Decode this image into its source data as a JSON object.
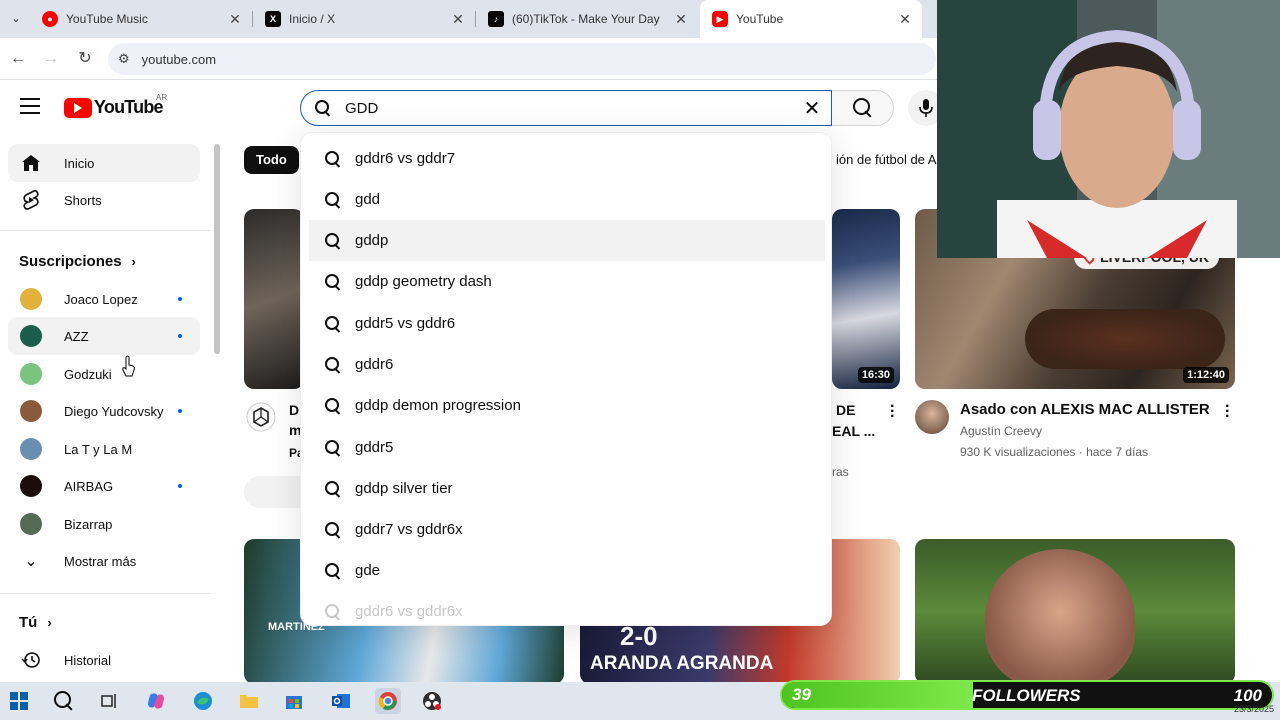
{
  "browser": {
    "tabs": [
      {
        "title": "YouTube Music",
        "favicon_color": "#ff0000"
      },
      {
        "title": "Inicio / X",
        "favicon_color": "#000000"
      },
      {
        "title": "(60)TikTok - Make Your Day",
        "favicon_color": "#000000"
      },
      {
        "title": "YouTube",
        "favicon_color": "#ff0000",
        "active": true
      }
    ],
    "close_glyph": "✕",
    "url": "youtube.com"
  },
  "masthead": {
    "logo_text": "YouTube",
    "region": "AR",
    "search_value": "GDD",
    "clear_glyph": "✕"
  },
  "sidebar": {
    "main": [
      {
        "label": "Inicio"
      },
      {
        "label": "Shorts"
      }
    ],
    "subscriptions_heading": "Suscripciones",
    "subscriptions": [
      {
        "label": "Joaco Lopez",
        "new": true,
        "color": "#e0b23a"
      },
      {
        "label": "AZZ",
        "new": true,
        "color": "#1a5e4a"
      },
      {
        "label": "Godzuki",
        "new": false,
        "color": "#7bc47f"
      },
      {
        "label": "Diego Yudcovsky",
        "new": true,
        "color": "#8a5a3c"
      },
      {
        "label": "La T y La M",
        "new": false,
        "color": "#6a8fb0"
      },
      {
        "label": "AIRBAG",
        "new": true,
        "color": "#1b0d0d"
      },
      {
        "label": "Bizarrap",
        "new": false,
        "color": "#556b55"
      }
    ],
    "show_more": "Mostrar más",
    "you_heading": "Tú",
    "history": "Historial"
  },
  "chips": {
    "all": "Todo",
    "partial": "ión de fútbol de A"
  },
  "videos": {
    "left_partial": {
      "title_1": "D",
      "title_2": "m",
      "meta": "Pa"
    },
    "middle_partial": {
      "title_1": "DE",
      "title_2": "EAL ...",
      "meta": "ras",
      "duration": "16:30"
    },
    "featured": {
      "title": "Asado con ALEXIS MAC ALLISTER",
      "channel": "Agustín Creevy",
      "stats": "930 K visualizaciones · hace 7 días",
      "duration": "1:12:40",
      "badge": "LIVERPOOL, UK"
    },
    "bottom_middle_text_1": "2-0",
    "bottom_middle_text_2": "ARANDA AGRANDA",
    "bottom_left_text": "MARTINEZ"
  },
  "suggestions": [
    "gddr6 vs gddr7",
    "gdd",
    "gddp",
    "gddp geometry dash",
    "gddr5 vs gddr6",
    "gddr6",
    "gddp demon progression",
    "gddr5",
    "gddp silver tier",
    "gddr7 vs gddr6x",
    "gde",
    "gddr6 vs gddr6x"
  ],
  "overlay": {
    "followers_count": "39",
    "followers_label": "FOLLOWERS",
    "followers_goal": "100",
    "followers_progress": 0.39,
    "progress_color": "#7ee84a"
  },
  "taskbar": {
    "date": "23/3/2025"
  }
}
